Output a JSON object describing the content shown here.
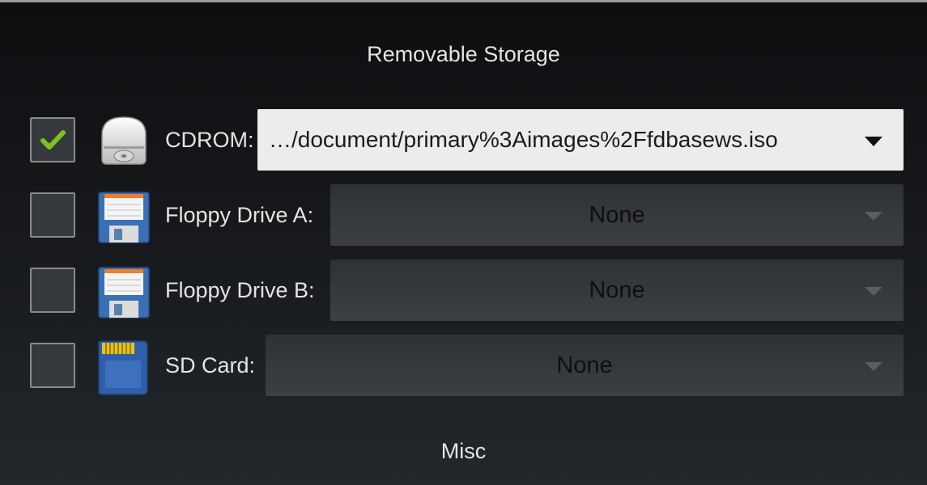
{
  "sections": {
    "removable_storage_title": "Removable Storage",
    "misc_title": "Misc"
  },
  "devices": [
    {
      "id": "cdrom",
      "label": "CDROM:",
      "checked": true,
      "icon": "cdrom-drive-icon",
      "value": "…/document/primary%3Aimages%2Ffdbasews.iso",
      "enabled": true
    },
    {
      "id": "floppy-a",
      "label": "Floppy Drive A:",
      "checked": false,
      "icon": "floppy-disk-icon",
      "value": "None",
      "enabled": false
    },
    {
      "id": "floppy-b",
      "label": "Floppy Drive B:",
      "checked": false,
      "icon": "floppy-disk-icon",
      "value": "None",
      "enabled": false
    },
    {
      "id": "sd-card",
      "label": "SD Card:",
      "checked": false,
      "icon": "sd-card-icon",
      "value": "None",
      "enabled": false
    }
  ],
  "colors": {
    "check_mark": "#7dc31d",
    "dropdown_active_bg": "#ececec",
    "background_top": "#0d0e10",
    "background_bottom": "#23272b"
  }
}
